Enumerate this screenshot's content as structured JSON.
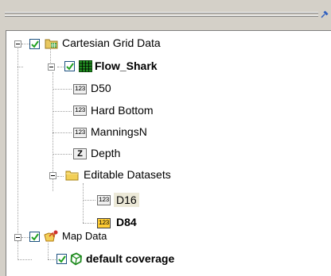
{
  "tree": {
    "cartesian": {
      "label": "Cartesian Grid Data",
      "expanded": true,
      "checked": true,
      "icon": "grid-folder-icon"
    },
    "flow_shark": {
      "label": "Flow_Shark",
      "expanded": true,
      "checked": true,
      "icon": "green-grid-icon"
    },
    "datasets": [
      {
        "label": "D50",
        "badge": "123",
        "icon": "scalar-dataset-icon"
      },
      {
        "label": "Hard Bottom",
        "badge": "123",
        "icon": "scalar-dataset-icon"
      },
      {
        "label": "ManningsN",
        "badge": "123",
        "icon": "scalar-dataset-icon"
      },
      {
        "label": "Depth",
        "badge": "Z",
        "icon": "elevation-dataset-icon"
      }
    ],
    "editable": {
      "label": "Editable Datasets",
      "expanded": true,
      "icon": "folder-icon"
    },
    "editable_items": [
      {
        "label": "D16",
        "badge": "123",
        "selected": true
      },
      {
        "label": "D84",
        "badge": "123",
        "active": true
      }
    ],
    "map_data": {
      "label": "Map Data",
      "expanded": true,
      "checked": true,
      "icon": "map-data-icon"
    },
    "coverage": {
      "label": "default coverage",
      "checked": true,
      "icon": "coverage-icon"
    }
  },
  "colors": {
    "selection": "#ece9d8",
    "active_badge": "#ffcc33",
    "grid_green": "#1f8a1f"
  }
}
